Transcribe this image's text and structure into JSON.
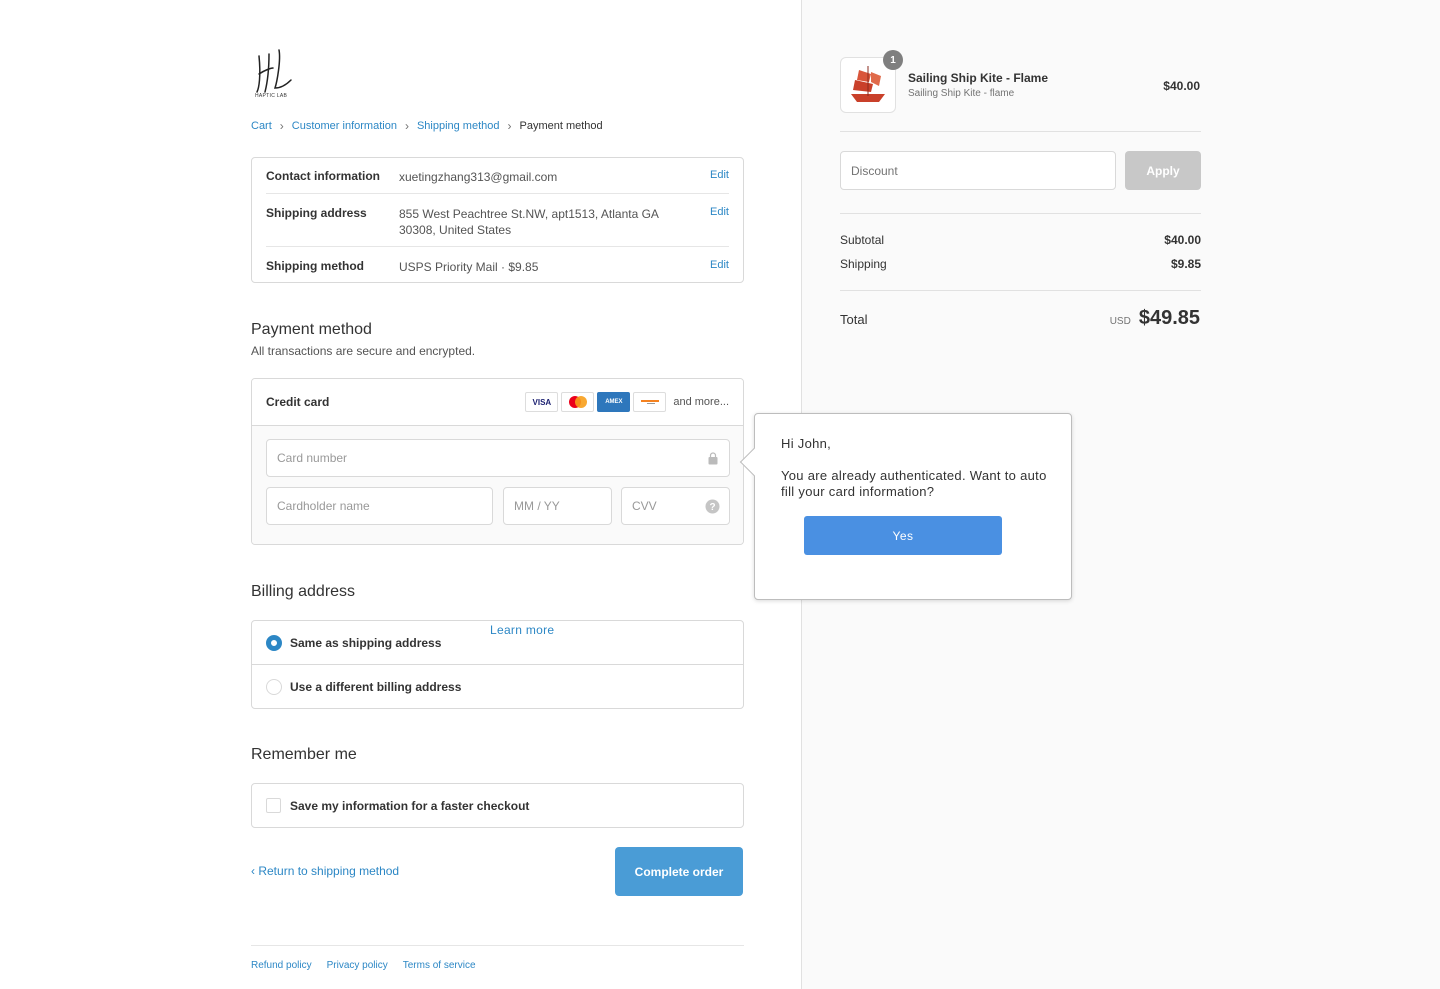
{
  "brand": {
    "logo_text": "HAPTIC LAB"
  },
  "breadcrumb": {
    "cart": "Cart",
    "customer": "Customer information",
    "shipping": "Shipping method",
    "payment": "Payment method",
    "sep": "›"
  },
  "review": {
    "contact": {
      "label": "Contact information",
      "value": "xuetingzhang313@gmail.com",
      "edit": "Edit"
    },
    "address": {
      "label": "Shipping address",
      "value": "855 West Peachtree St.NW, apt1513, Atlanta GA 30308, United States",
      "edit": "Edit"
    },
    "method": {
      "label": "Shipping method",
      "value": "USPS Priority Mail · $9.85",
      "edit": "Edit"
    }
  },
  "payment": {
    "title": "Payment method",
    "subtitle": "All transactions are secure and encrypted.",
    "credit_card": "Credit card",
    "cards": [
      "VISA",
      "AMEX"
    ],
    "and_more": "and more...",
    "card_number": "Card number",
    "cardholder": "Cardholder name",
    "expiry": "MM / YY",
    "cvv": "CVV"
  },
  "billing": {
    "title": "Billing address",
    "same": "Same as shipping address",
    "different": "Use a different billing address",
    "learn_more": "Learn more"
  },
  "remember": {
    "title": "Remember me",
    "save": "Save my information for a faster checkout"
  },
  "actions": {
    "back": "Return to shipping method",
    "complete": "Complete order"
  },
  "footer": {
    "refund": "Refund policy",
    "privacy": "Privacy policy",
    "terms": "Terms of service"
  },
  "summary": {
    "qty": "1",
    "product": "Sailing Ship Kite - Flame",
    "variant": "Sailing Ship Kite - flame",
    "price": "$40.00",
    "discount_placeholder": "Discount",
    "apply": "Apply",
    "subtotal_label": "Subtotal",
    "subtotal": "$40.00",
    "shipping_label": "Shipping",
    "shipping": "$9.85",
    "total_label": "Total",
    "currency": "USD",
    "total": "$49.85"
  },
  "popup": {
    "greeting": "Hi John,",
    "message": "You are already authenticated. Want to auto fill your card information?",
    "yes": "Yes"
  },
  "colors": {
    "accent": "#2c87c5",
    "button": "#4a9cd6",
    "popup_button": "#4a90e2",
    "apply_disabled": "#c8c8c8"
  }
}
